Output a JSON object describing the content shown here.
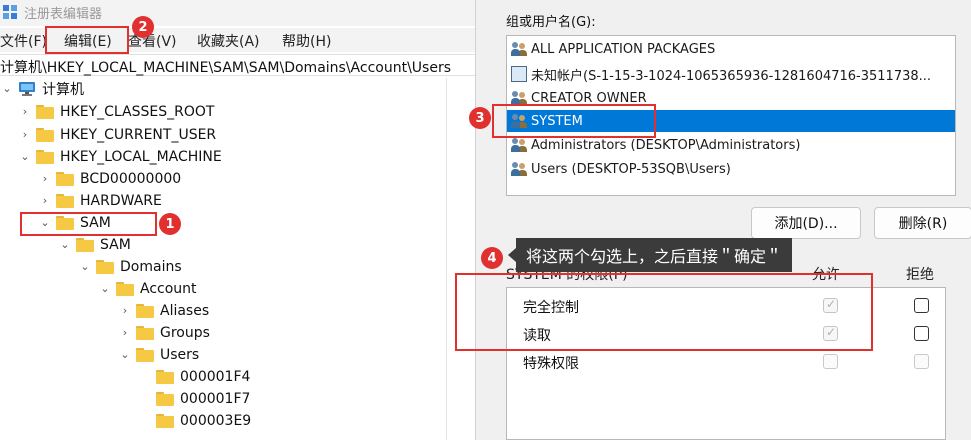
{
  "regedit": {
    "title": "注册表编辑器",
    "menu": [
      "文件(F)",
      "编辑(E)",
      "查看(V)",
      "收藏夹(A)",
      "帮助(H)"
    ],
    "address": "计算机\\HKEY_LOCAL_MACHINE\\SAM\\SAM\\Domains\\Account\\Users",
    "tree": [
      {
        "label": "计算机",
        "chev": "v",
        "icon": "computer"
      },
      {
        "label": "HKEY_CLASSES_ROOT",
        "chev": ">"
      },
      {
        "label": "HKEY_CURRENT_USER",
        "chev": ">"
      },
      {
        "label": "HKEY_LOCAL_MACHINE",
        "chev": "v"
      },
      {
        "label": "BCD00000000",
        "chev": ">"
      },
      {
        "label": "HARDWARE",
        "chev": ">"
      },
      {
        "label": "SAM",
        "chev": "v"
      },
      {
        "label": "SAM",
        "chev": "v"
      },
      {
        "label": "Domains",
        "chev": "v"
      },
      {
        "label": "Account",
        "chev": "v"
      },
      {
        "label": "Aliases",
        "chev": ">"
      },
      {
        "label": "Groups",
        "chev": ">"
      },
      {
        "label": "Users",
        "chev": "v"
      },
      {
        "label": "000001F4",
        "chev": ""
      },
      {
        "label": "000001F7",
        "chev": ""
      },
      {
        "label": "000003E9",
        "chev": ""
      }
    ]
  },
  "dialog": {
    "group_label": "组或用户名(G):",
    "users": [
      {
        "label": "ALL APPLICATION PACKAGES",
        "icon": "people"
      },
      {
        "label": "未知帐户(S-1-15-3-1024-1065365936-1281604716-3511738...",
        "icon": "unknown"
      },
      {
        "label": "CREATOR OWNER",
        "icon": "people"
      },
      {
        "label": "SYSTEM",
        "icon": "people",
        "selected": true
      },
      {
        "label": "Administrators (DESKTOP\\Administrators)",
        "icon": "people"
      },
      {
        "label": "Users (DESKTOP-53SQB\\Users)",
        "icon": "people"
      }
    ],
    "add_button": "添加(D)...",
    "remove_button": "删除(R)",
    "perm_header": "SYSTEM 的权限(P)",
    "allow_header": "允许",
    "deny_header": "拒绝",
    "permissions": [
      {
        "label": "完全控制",
        "allow": "checked-disabled",
        "deny": "unchecked"
      },
      {
        "label": "读取",
        "allow": "checked-disabled",
        "deny": "unchecked"
      },
      {
        "label": "特殊权限",
        "allow": "disabled",
        "deny": "disabled"
      }
    ]
  },
  "annotations": {
    "badges": [
      "1",
      "2",
      "3",
      "4"
    ],
    "tooltip": "将这两个勾选上，之后直接＂确定＂"
  },
  "colors": {
    "annotation_red": "#e0302f",
    "selection_blue": "#0078d7",
    "folder_yellow": "#f6c945"
  }
}
